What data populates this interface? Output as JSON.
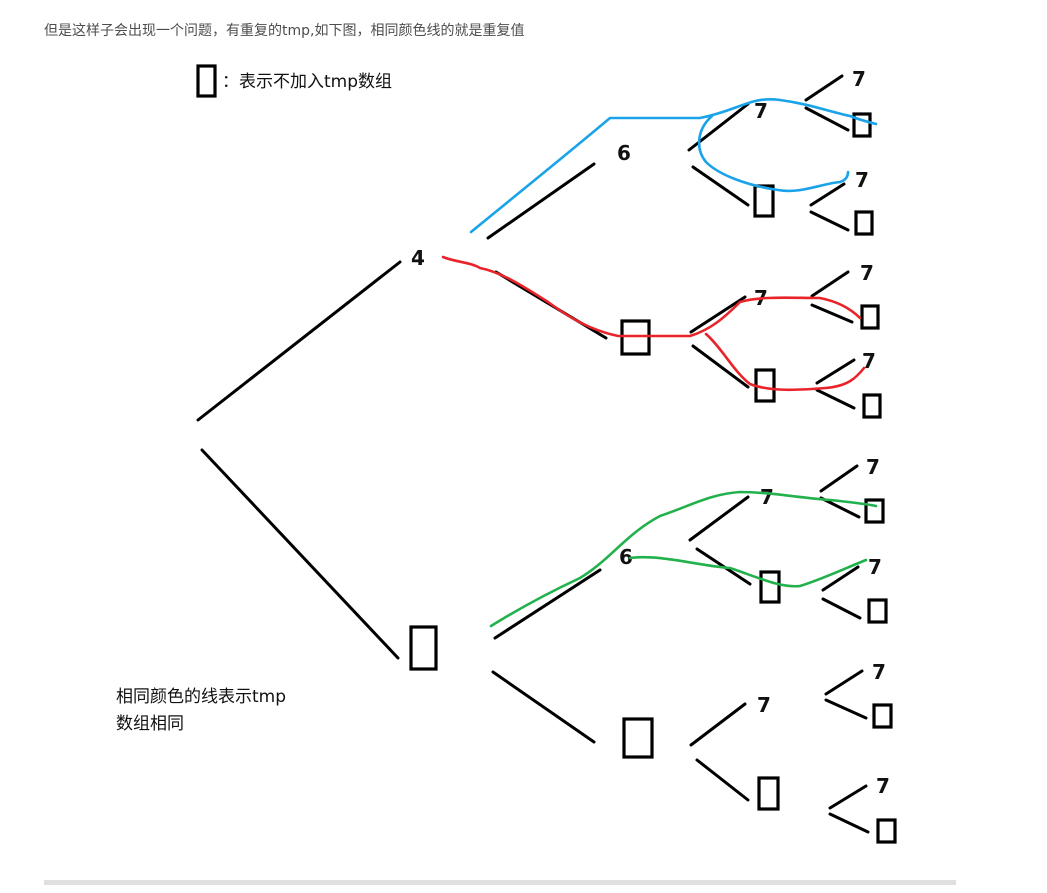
{
  "intro_text": "但是这样子会出现一个问题，有重复的tmp,如下图，相同颜色线的就是重复值",
  "legend": {
    "symbol": "empty-box",
    "text": "：表示不加入tmp数组"
  },
  "note": {
    "line1": "相同颜色的线表示tmp",
    "line2": "数组相同"
  },
  "node_labels": {
    "root_upper": "4",
    "l2_upper_top": "6",
    "l2_lower_top": "6",
    "l3": [
      "7",
      "7",
      "7",
      "7"
    ],
    "leaves": [
      "7",
      "7",
      "7",
      "7",
      "7",
      "7",
      "7",
      "7"
    ]
  },
  "colors": {
    "blue": "#1aa3e8",
    "red": "#e8232a",
    "green": "#22b14c",
    "ink": "#000000"
  }
}
